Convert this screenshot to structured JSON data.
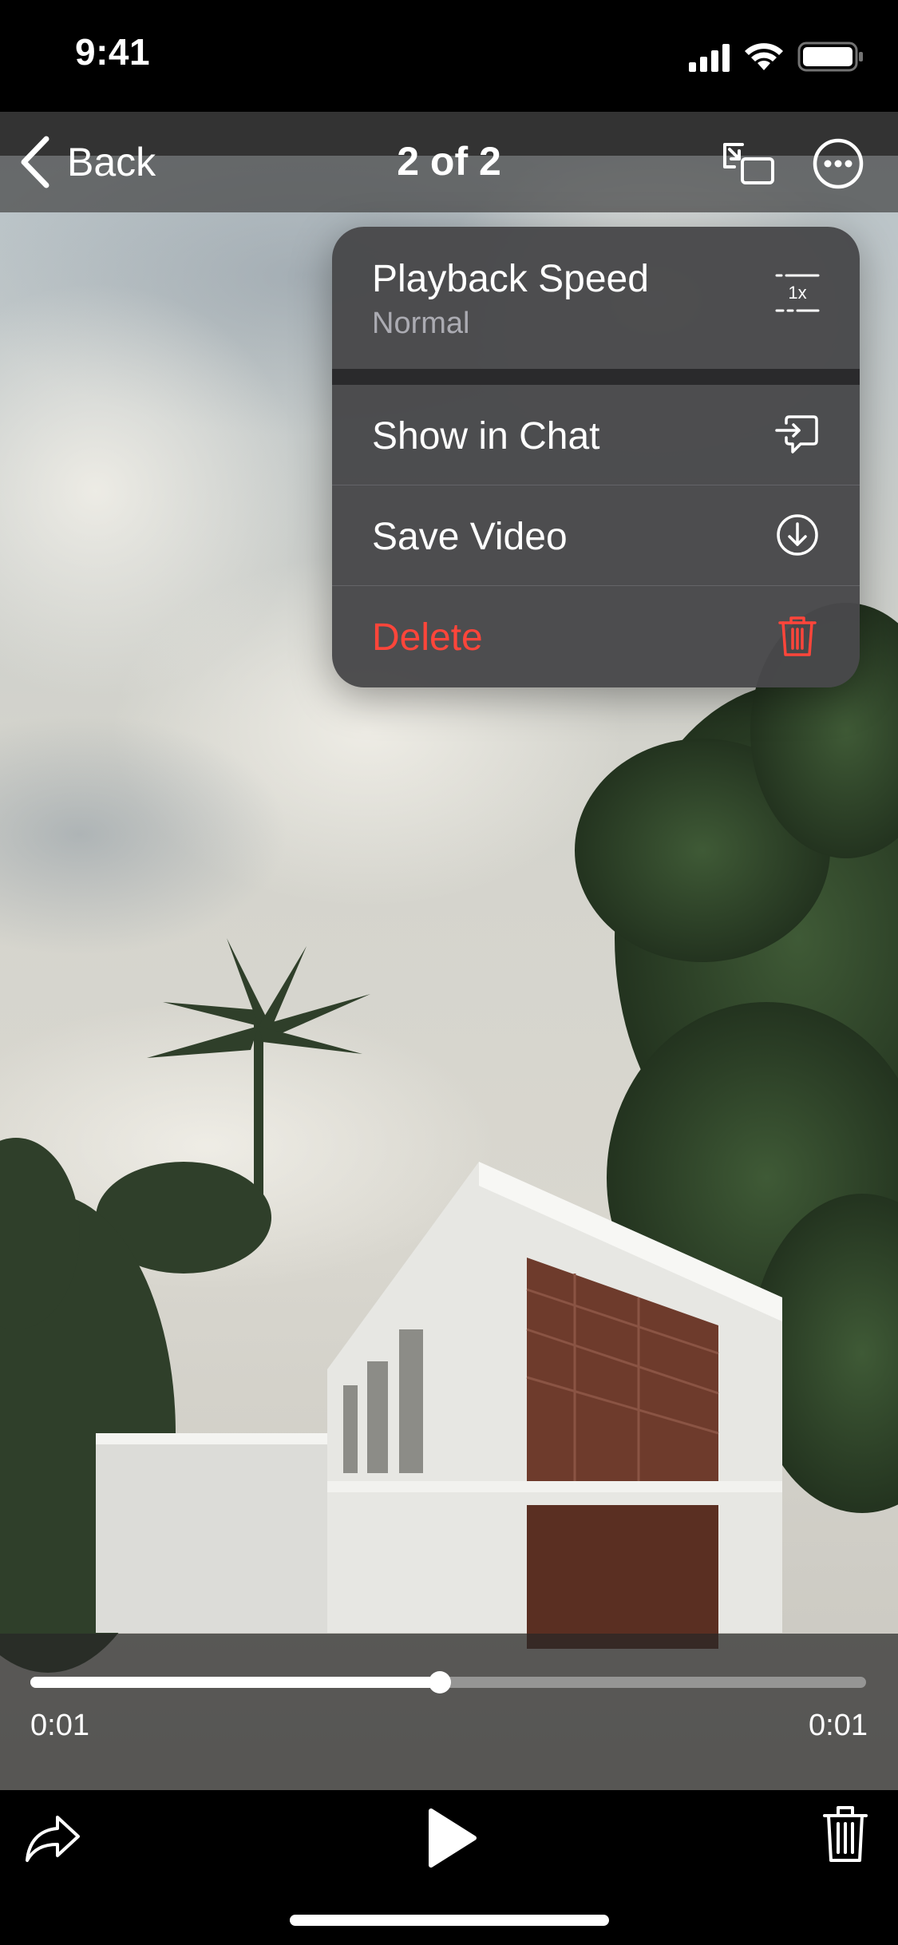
{
  "status_bar": {
    "time": "9:41"
  },
  "nav": {
    "back_label": "Back",
    "title": "2 of 2",
    "icons": [
      "chevron-left-icon",
      "picture-in-picture-icon",
      "more-icon"
    ]
  },
  "menu": {
    "playback_speed": {
      "label": "Playback Speed",
      "value": "Normal",
      "icon": "playback-speed-1x-icon",
      "icon_text": "1x"
    },
    "show_in_chat": {
      "label": "Show in Chat",
      "icon": "show-in-chat-icon"
    },
    "save_video": {
      "label": "Save Video",
      "icon": "download-circle-icon"
    },
    "delete": {
      "label": "Delete",
      "icon": "trash-icon"
    }
  },
  "player": {
    "elapsed": "0:01",
    "total": "0:01",
    "progress": 0.49
  },
  "toolbar": {
    "icons": [
      "forward-share-icon",
      "play-icon",
      "trash-icon"
    ]
  },
  "colors": {
    "destructive": "#FF453A",
    "menu_background": "#48484A",
    "text_primary": "#FFFFFF",
    "text_secondary": "#8E8E93"
  }
}
